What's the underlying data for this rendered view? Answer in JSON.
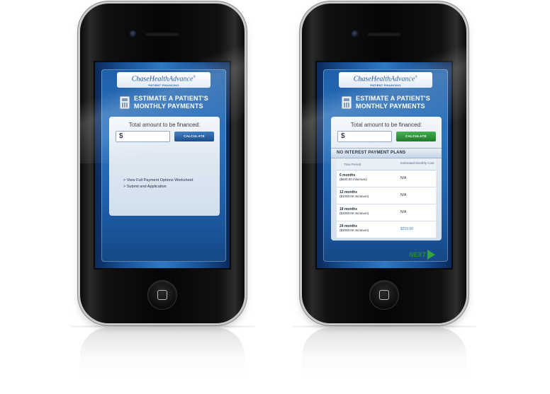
{
  "brand": {
    "logo_main": "ChaseHealthAdvance",
    "logo_mark": "®",
    "logo_sub": "PATIENT FINANCING"
  },
  "heading": {
    "line1": "ESTIMATE A PATIENT'S",
    "line2": "MONTHLY PAYMENTS"
  },
  "form": {
    "label": "Total amount to be financed:",
    "currency_symbol": "$",
    "amount_value": "",
    "calculate_label": "CALCULATE"
  },
  "left_screen": {
    "links": [
      "> View Full Payment Options Worksheet",
      "> Submit and Application"
    ]
  },
  "right_screen": {
    "plans_title": "NO INTEREST PAYMENT PLANS",
    "columns": [
      "Time Period",
      "Estimated Monthly Cost"
    ],
    "rows": [
      {
        "term": "6 months",
        "minimum": "($500.00 minimum)",
        "cost": "N/A"
      },
      {
        "term": "12 months",
        "minimum": "($1000.00 minimum)",
        "cost": "N/A"
      },
      {
        "term": "18 months",
        "minimum": "($2000.00 minimum)",
        "cost": "N/A"
      },
      {
        "term": "24 months",
        "minimum": "($3000.00 minimum)",
        "cost": "$210.00"
      }
    ],
    "next_label": "NEXT"
  },
  "colors": {
    "brand_blue": "#1a4f93",
    "calculate_blue": "#1b4d8a",
    "calculate_green": "#1f7a2a",
    "next_green": "#35a63f",
    "highlight_cost": "#2a78c9"
  }
}
